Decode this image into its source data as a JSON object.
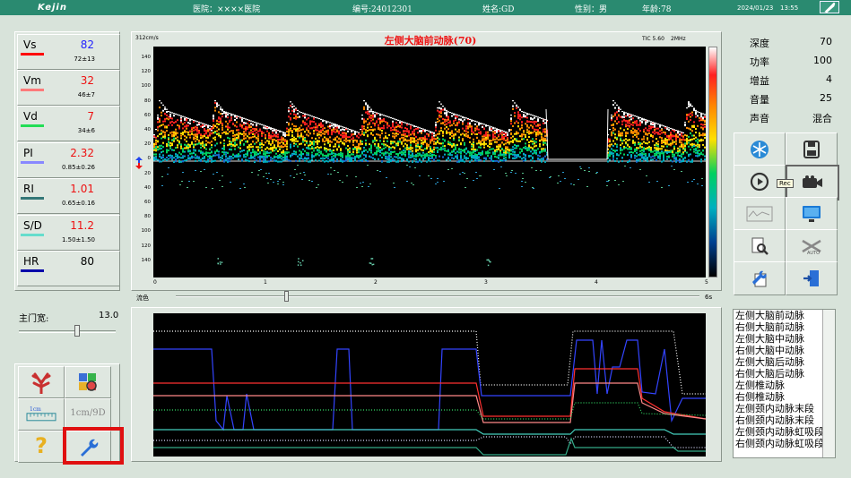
{
  "header": {
    "brand": "Kejin",
    "hospital": "医院：××××医院",
    "id_label": "编号:24012301",
    "name_label": "姓名:GD",
    "sex_label": "性别：男",
    "age_label": "年龄:78",
    "date": "2024/01/23",
    "time": "13:55"
  },
  "measurements": [
    {
      "label": "Vs",
      "value": "82",
      "ref": "72±13",
      "color": "#ff0000",
      "value_color": "#2222ff"
    },
    {
      "label": "Vm",
      "value": "32",
      "ref": "46±7",
      "color": "#ff7a7a",
      "value_color": "#ee1111"
    },
    {
      "label": "Vd",
      "value": "7",
      "ref": "34±6",
      "color": "#22dd55",
      "value_color": "#ee1111"
    },
    {
      "label": "PI",
      "value": "2.32",
      "ref": "0.85±0.26",
      "color": "#8888ff",
      "value_color": "#ee1111"
    },
    {
      "label": "RI",
      "value": "1.01",
      "ref": "0.65±0.16",
      "color": "#337777",
      "value_color": "#ee1111"
    },
    {
      "label": "S/D",
      "value": "11.2",
      "ref": "1.50±1.50",
      "color": "#66ddcc",
      "value_color": "#ee1111"
    },
    {
      "label": "HR",
      "value": "80",
      "ref": "",
      "color": "#0000aa",
      "value_color": "#000000"
    }
  ],
  "gate": {
    "label": "主门宽:",
    "value": "13.0"
  },
  "spectrum": {
    "title": "左侧大脑前动脉(70)",
    "scale_label": "312cm/s",
    "tic_label": "TIC 5.60",
    "freq_label": "2MHz",
    "y_ticks": [
      "140",
      "120",
      "100",
      "80",
      "60",
      "40",
      "20",
      "0",
      "20",
      "40",
      "60",
      "80",
      "100",
      "120",
      "140"
    ],
    "x_ticks": [
      "0",
      "1",
      "2",
      "3",
      "4",
      "5"
    ],
    "slider_left": "流色",
    "slider_right": "6s"
  },
  "params": [
    {
      "label": "深度",
      "value": "70"
    },
    {
      "label": "功率",
      "value": "100"
    },
    {
      "label": "增益",
      "value": "4"
    },
    {
      "label": "音量",
      "value": "25"
    },
    {
      "label": "声音",
      "value": "混合"
    }
  ],
  "side_buttons": {
    "record_tooltip": "Rec"
  },
  "bottom_buttons": {
    "scale_label": "1cm",
    "ratio_label": "1cm/9D"
  },
  "vessels": [
    "左侧大脑前动脉",
    "右侧大脑前动脉",
    "左侧大脑中动脉",
    "右侧大脑中动脉",
    "左侧大脑后动脉",
    "右侧大脑后动脉",
    "左侧椎动脉",
    "右侧椎动脉",
    "左侧颈内动脉末段",
    "右侧颈内动脉末段",
    "左侧颈内动脉虹吸段",
    "右侧颈内动脉虹吸段"
  ],
  "colors": {
    "accent_header": "#2a8a70",
    "highlight": "#e01010",
    "screen_bg": "#000000"
  }
}
